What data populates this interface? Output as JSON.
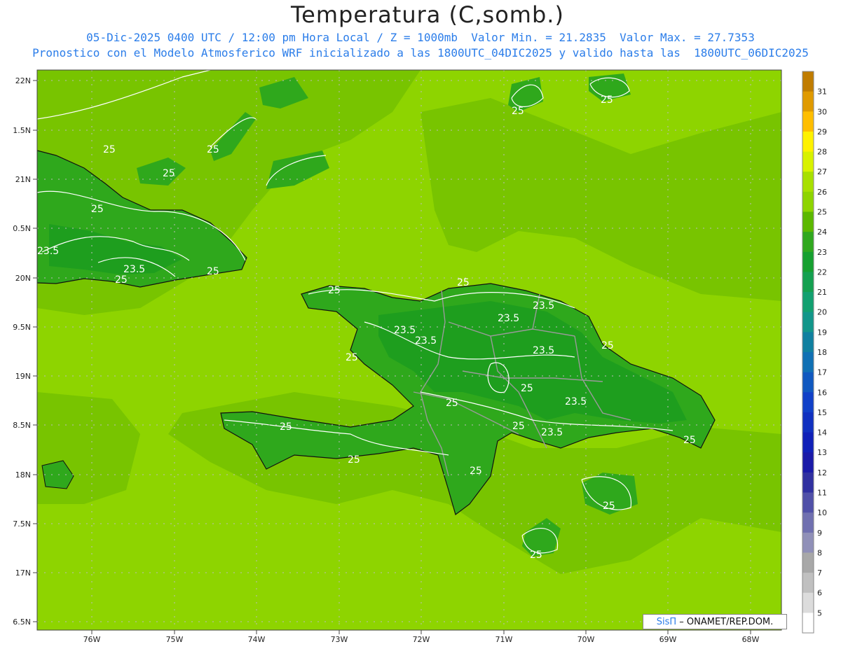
{
  "title": "Temperatura (C,somb.)",
  "subtitle_line1": "05-Dic-2025 0400 UTC / 12:00 pm Hora Local / Z = 1000mb  Valor Min. = 21.2835  Valor Max. = 27.7353",
  "subtitle_line2": "Pronostico con el Modelo Atmosferico WRF inicializado a las 1800UTC_04DIC2025 y valido hasta las  1800UTC_06DIC2025",
  "credit": {
    "brand": "SisΠ",
    "text": " – ONAMET/REP.DOM."
  },
  "colors": {
    "ocean_fill": "#8ed400",
    "land_dark": "#1e9e1e",
    "land_mid": "#3fae1f",
    "coast": "#111111",
    "contour": "#ffffff",
    "border": "#999999",
    "grid": "#bbbbbb"
  },
  "lat_labels": [
    "22N",
    "1.5N",
    "21N",
    "0.5N",
    "20N",
    "9.5N",
    "19N",
    "8.5N",
    "18N",
    "7.5N",
    "17N",
    "6.5N"
  ],
  "lon_labels": [
    "76W",
    "75W",
    "74W",
    "73W",
    "72W",
    "71W",
    "70W",
    "69W",
    "68W"
  ],
  "contour_labels": [
    "25",
    "25",
    "25",
    "25",
    "25",
    "23.5",
    "23.5",
    "25",
    "25",
    "25",
    "25",
    "23.5",
    "23.5",
    "23.5",
    "23.5",
    "23.5",
    "23.5",
    "25",
    "25",
    "25",
    "25",
    "25",
    "25",
    "23.5",
    "25",
    "25",
    "25",
    "25",
    "25",
    "25"
  ],
  "colorbar": {
    "labels": [
      "31",
      "30",
      "29",
      "28",
      "27",
      "26",
      "25",
      "24",
      "23",
      "22",
      "21",
      "20",
      "19",
      "18",
      "17",
      "16",
      "15",
      "14",
      "13",
      "12",
      "11",
      "10",
      "9",
      "8",
      "7",
      "6",
      "5"
    ],
    "colors": [
      "#c07c00",
      "#e09a00",
      "#ffbe00",
      "#fff200",
      "#d8f200",
      "#a8e000",
      "#8ed400",
      "#5cb800",
      "#30a81e",
      "#16a030",
      "#14a050",
      "#12a070",
      "#12968a",
      "#1080a0",
      "#1070b4",
      "#1058c0",
      "#1040c8",
      "#1030c0",
      "#1020b8",
      "#1a1aa8",
      "#3030a0",
      "#5050a8",
      "#7070b0",
      "#9090b8",
      "#a8a8a8",
      "#c0c0c0",
      "#dcdcdc",
      "#ffffff"
    ]
  }
}
